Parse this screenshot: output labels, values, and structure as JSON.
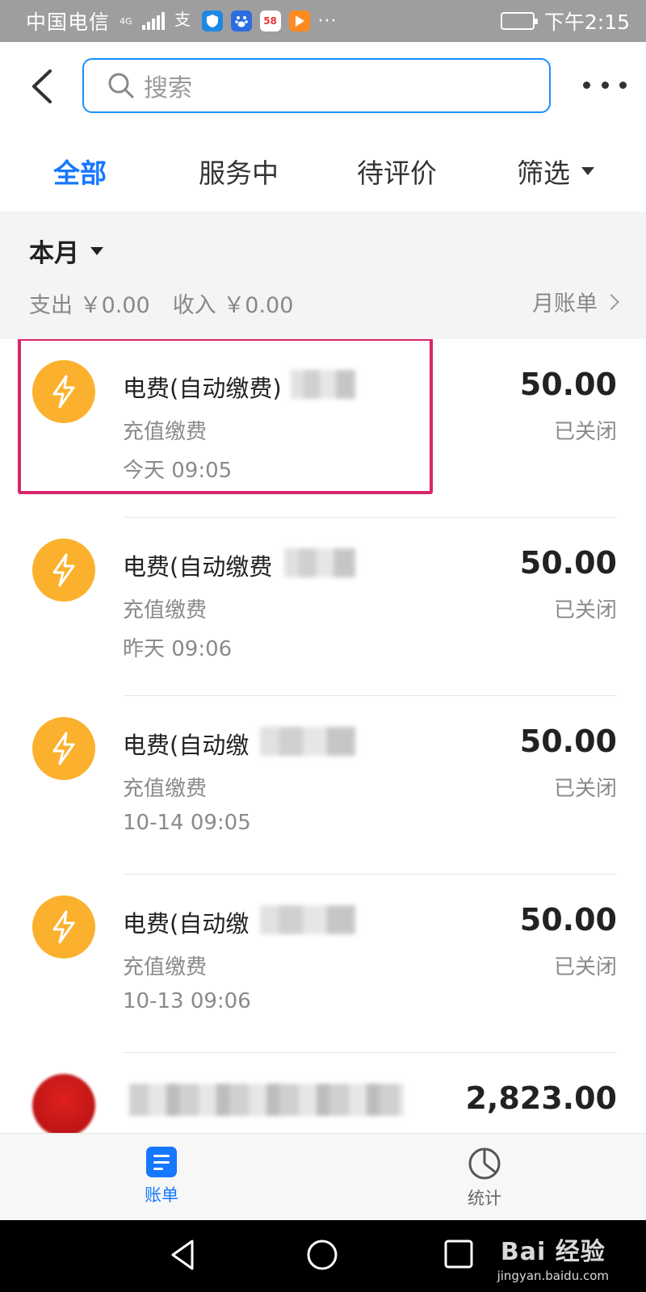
{
  "status_bar": {
    "carrier": "中国电信",
    "network": "4G",
    "time": "下午2:15",
    "more": "···",
    "app_58": "58",
    "battery_level": 1.0
  },
  "header": {
    "search_placeholder": "搜索"
  },
  "tabs": {
    "all": "全部",
    "in_service": "服务中",
    "to_review": "待评价",
    "filter": "筛选"
  },
  "summary": {
    "month": "本月",
    "expense": "支出 ￥0.00",
    "income": "收入 ￥0.00",
    "monthly_bill": "月账单"
  },
  "transactions": [
    {
      "title": "电费(自动缴费)",
      "category": "充值缴费",
      "time": "今天  09:05",
      "amount": "50.00",
      "status": "已关闭"
    },
    {
      "title": "电费(自动缴费",
      "category": "充值缴费",
      "time": "昨天  09:06",
      "amount": "50.00",
      "status": "已关闭"
    },
    {
      "title": "电费(自动缴",
      "category": "充值缴费",
      "time": "10-14  09:05",
      "amount": "50.00",
      "status": "已关闭"
    },
    {
      "title": "电费(自动缴",
      "category": "充值缴费",
      "time": "10-13  09:06",
      "amount": "50.00",
      "status": "已关闭"
    },
    {
      "amount": "2,823.00"
    }
  ],
  "bottom_tabs": {
    "bill": "账单",
    "stats": "统计"
  },
  "watermark": {
    "main": "Bai 经验",
    "sub": "jingyan.baidu.com"
  },
  "colors": {
    "accent": "#1677ff",
    "highlight": "#d8266b",
    "icon_bg": "#fbb12d"
  }
}
